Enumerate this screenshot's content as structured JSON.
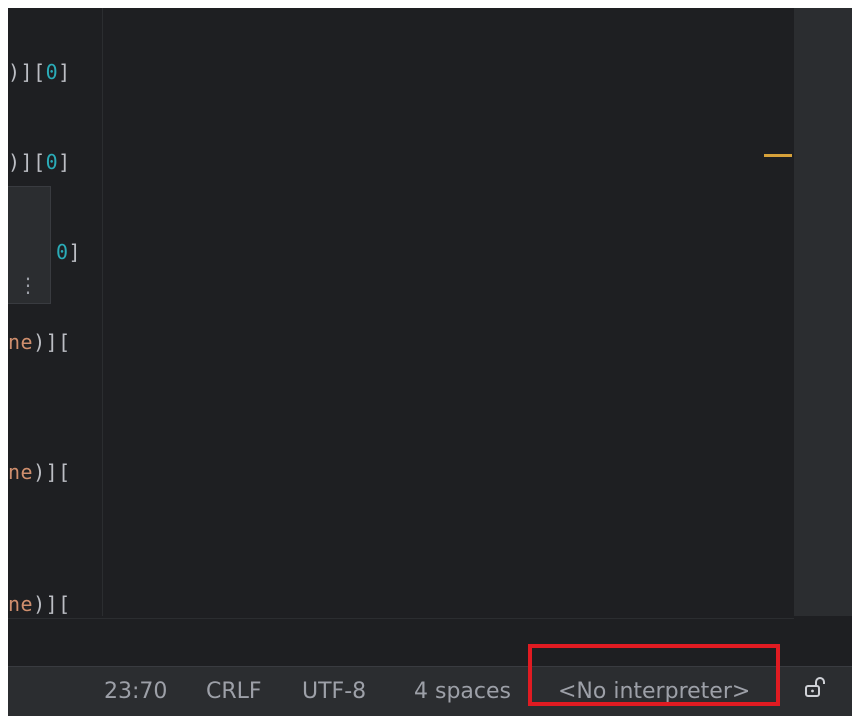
{
  "editor": {
    "lines": [
      {
        "parts": [
          {
            "t": ")][",
            "k": "b"
          },
          {
            "t": "0",
            "k": "n"
          },
          {
            "t": "]",
            "k": "b"
          }
        ]
      },
      {
        "parts": [
          {
            "t": ")][",
            "k": "b"
          },
          {
            "t": "0",
            "k": "n"
          },
          {
            "t": "]",
            "k": "b"
          }
        ]
      },
      {
        "parts": [
          {
            "t": "0",
            "k": "n"
          },
          {
            "t": "]",
            "k": "b"
          }
        ]
      },
      {
        "parts": [
          {
            "t": "ne",
            "k": "o"
          },
          {
            "t": ")][",
            "k": "b"
          }
        ]
      },
      {
        "parts": [
          {
            "t": "ne",
            "k": "o"
          },
          {
            "t": ")][",
            "k": "b"
          }
        ]
      },
      {
        "parts": [
          {
            "t": "ne",
            "k": "o"
          },
          {
            "t": ")][",
            "k": "b"
          }
        ]
      }
    ],
    "popup_icon": "more-vertical-icon",
    "marker_color": "#d6a13a"
  },
  "status_bar": {
    "position": "23:70",
    "line_separator": "CRLF",
    "encoding": "UTF-8",
    "indent": "4 spaces",
    "interpreter": "<No interpreter>",
    "lock_icon": "unlock-icon"
  },
  "highlight_color": "#e01b22"
}
